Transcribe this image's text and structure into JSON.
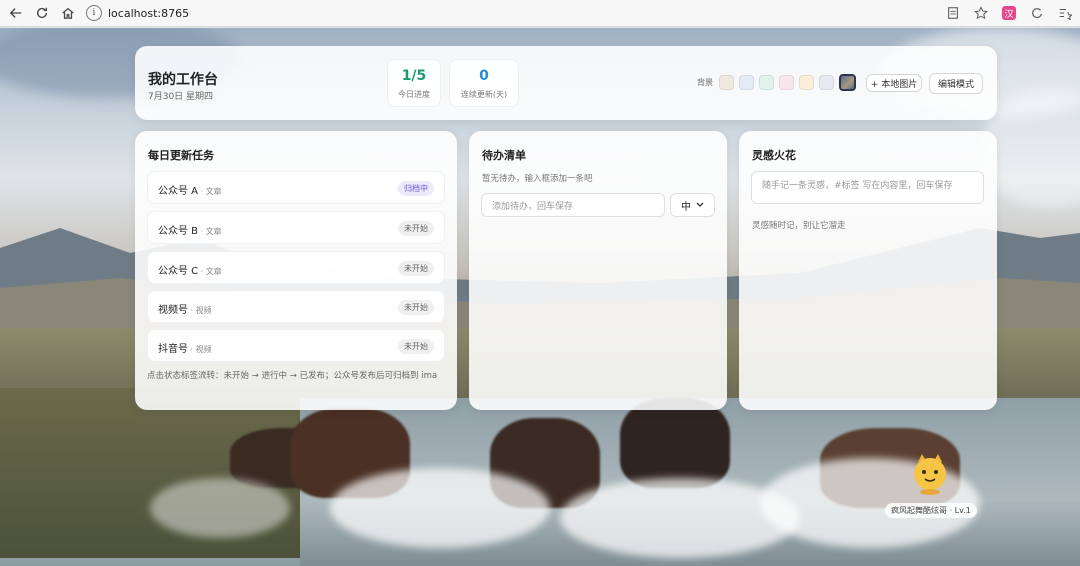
{
  "browser": {
    "url": "localhost:8765",
    "extension_badge": "汉"
  },
  "header": {
    "title": "我的工作台",
    "date": "7月30日 星期四",
    "stats": [
      {
        "value": "1/5",
        "label": "今日进度",
        "color": "#1a9a6c"
      },
      {
        "value": "0",
        "label": "连续更新(天)",
        "color": "#2a8bd0"
      }
    ],
    "background_label": "背景",
    "swatches": [
      "#efe9df",
      "#e4ecf8",
      "#e2f3ec",
      "#f8e6ec",
      "#fbeedd",
      "#e9e9f3"
    ],
    "local_image_button": "+ 本地图片",
    "edit_mode_button": "编辑模式"
  },
  "daily": {
    "title": "每日更新任务",
    "tasks": [
      {
        "name": "公众号 A",
        "type": " · 文章",
        "status": "归档中"
      },
      {
        "name": "公众号 B",
        "type": " · 文章",
        "status": "未开始"
      },
      {
        "name": "公众号 C",
        "type": " · 文章",
        "status": "未开始"
      },
      {
        "name": "视频号",
        "type": " · 视频",
        "status": "未开始"
      },
      {
        "name": "抖音号",
        "type": " · 视频",
        "status": "未开始"
      }
    ],
    "hint": "点击状态标签流转：未开始 → 进行中 → 已发布；公众号发布后可归档到 ima"
  },
  "todo": {
    "title": "待办清单",
    "empty": "暂无待办，输入框添加一条吧",
    "placeholder": "添加待办，回车保存",
    "priority": "中"
  },
  "ideas": {
    "title": "灵感火花",
    "placeholder": "随手记一条灵感，#标签 写在内容里，回车保存",
    "empty": "灵感随时记，别让它溜走"
  },
  "mascot": {
    "label": "疯风起舞酷炫哥 · Lv.1"
  }
}
